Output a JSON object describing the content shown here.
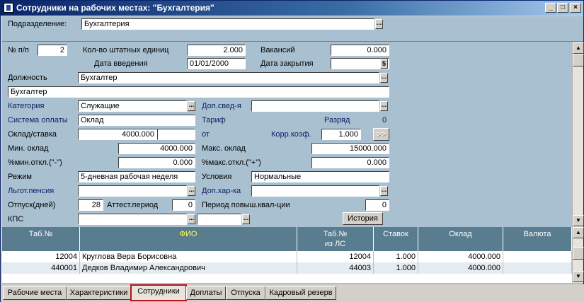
{
  "window": {
    "title": "Сотрудники на рабочих местах: \"Бухгалтерия\"",
    "min_glyph": "_",
    "max_glyph": "□",
    "close_glyph": "×"
  },
  "header": {
    "dept_label": "Подразделение:",
    "dept_value": "Бухгалтерия"
  },
  "form": {
    "num_label": "№ п/п",
    "num_value": "2",
    "staff_units_label": "Кол-во штатных единиц",
    "staff_units_value": "2.000",
    "vacancies_label": "Вакансий",
    "vacancies_value": "0.000",
    "intro_date_label": "Дата введения",
    "intro_date_value": "01/01/2000",
    "close_date_label": "Дата закрытия",
    "close_date_value": "",
    "calendar_glyph": "5",
    "position_label": "Должность",
    "position_value": "Бухгалтер",
    "position_full_value": "Бухгалтер",
    "category_label": "Категория",
    "category_value": "Служащие",
    "extra_info_label": "Доп.свед-я",
    "extra_info_value": "",
    "pay_system_label": "Система оплаты",
    "pay_system_value": "Оклад",
    "tariff_label": "Тариф",
    "grade_label": "Разряд",
    "grade_value": "0",
    "salary_label": "Оклад/ставка",
    "salary_value": "4000.000",
    "salary_extra_value": "",
    "from_label": "от",
    "corr_coef_label": "Корр.коэф.",
    "corr_coef_value": "1.000",
    "arrow_button_label": ">>",
    "min_salary_label": "Мин. оклад",
    "min_salary_value": "4000.000",
    "max_salary_label": "Макс. оклад",
    "max_salary_value": "15000.000",
    "min_dev_label": "%мин.откл.(\"-\")",
    "min_dev_value": "0.000",
    "max_dev_label": "%макс.откл.(\"+\")",
    "max_dev_value": "0.000",
    "mode_label": "Режим",
    "mode_value": "5-дневная рабочая неделя",
    "conditions_label": "Условия",
    "conditions_value": "Нормальные",
    "pension_label": "Льгот.пенсия",
    "pension_value": "",
    "extra_char_label": "Доп.хар-ка",
    "extra_char_value": "",
    "vacation_label": "Отпуск(дней)",
    "vacation_value": "28",
    "attest_label": "Аттест.период",
    "attest_value": "0",
    "qual_label": "Период повыш.квал-ции",
    "qual_value": "0",
    "kps_label": "КПС",
    "kps_value": "",
    "kps_value2": "",
    "history_button": "История",
    "dots_glyph": "..."
  },
  "grid": {
    "headers": [
      "Таб.№",
      "ФИО",
      "Таб.№\nиз ЛС",
      "Ставок",
      "Оклад",
      "Валюта"
    ],
    "rows": [
      [
        "12004",
        "Круглова Вера Борисовна",
        "12004",
        "1.000",
        "4000.000",
        ""
      ],
      [
        "440001",
        "Дедков Владимир Александрович",
        "44003",
        "1.000",
        "4000.000",
        ""
      ]
    ]
  },
  "tabs": [
    {
      "label": "Рабочие места",
      "active": false
    },
    {
      "label": "Характеристики",
      "active": false
    },
    {
      "label": "Сотрудники",
      "active": true
    },
    {
      "label": "Доплаты",
      "active": false
    },
    {
      "label": "Отпуска",
      "active": false
    },
    {
      "label": "Кадровый резерв",
      "active": false
    }
  ],
  "scroll": {
    "up_glyph": "▲",
    "down_glyph": "▼"
  }
}
